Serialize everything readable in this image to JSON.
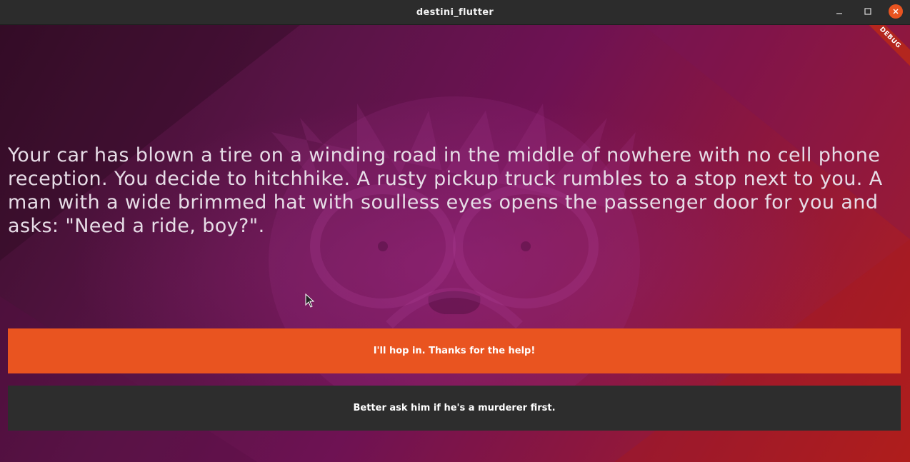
{
  "window": {
    "title": "destini_flutter",
    "controls": [
      "minimize-icon",
      "maximize-icon",
      "close-icon"
    ],
    "close_color": "#e95420"
  },
  "app": {
    "debug_banner": "DEBUG",
    "story_text": "Your car has blown a tire on a winding road in the middle of nowhere with no cell phone reception. You decide to hitchhike. A rusty pickup truck rumbles to a stop next to you. A man with a wide brimmed hat with soulless eyes opens the passenger door for you and asks: \"Need a ride, boy?\".",
    "choice1": {
      "label": "I'll hop in. Thanks for the help!",
      "color": "#e95420"
    },
    "choice2": {
      "label": "Better ask him if he's a murderer first.",
      "color": "#2d2d2d"
    }
  },
  "colors": {
    "accent": "#e95420",
    "titlebar": "#2c2c2c",
    "background_purple": "#6e1253",
    "background_red": "#b3201d"
  }
}
